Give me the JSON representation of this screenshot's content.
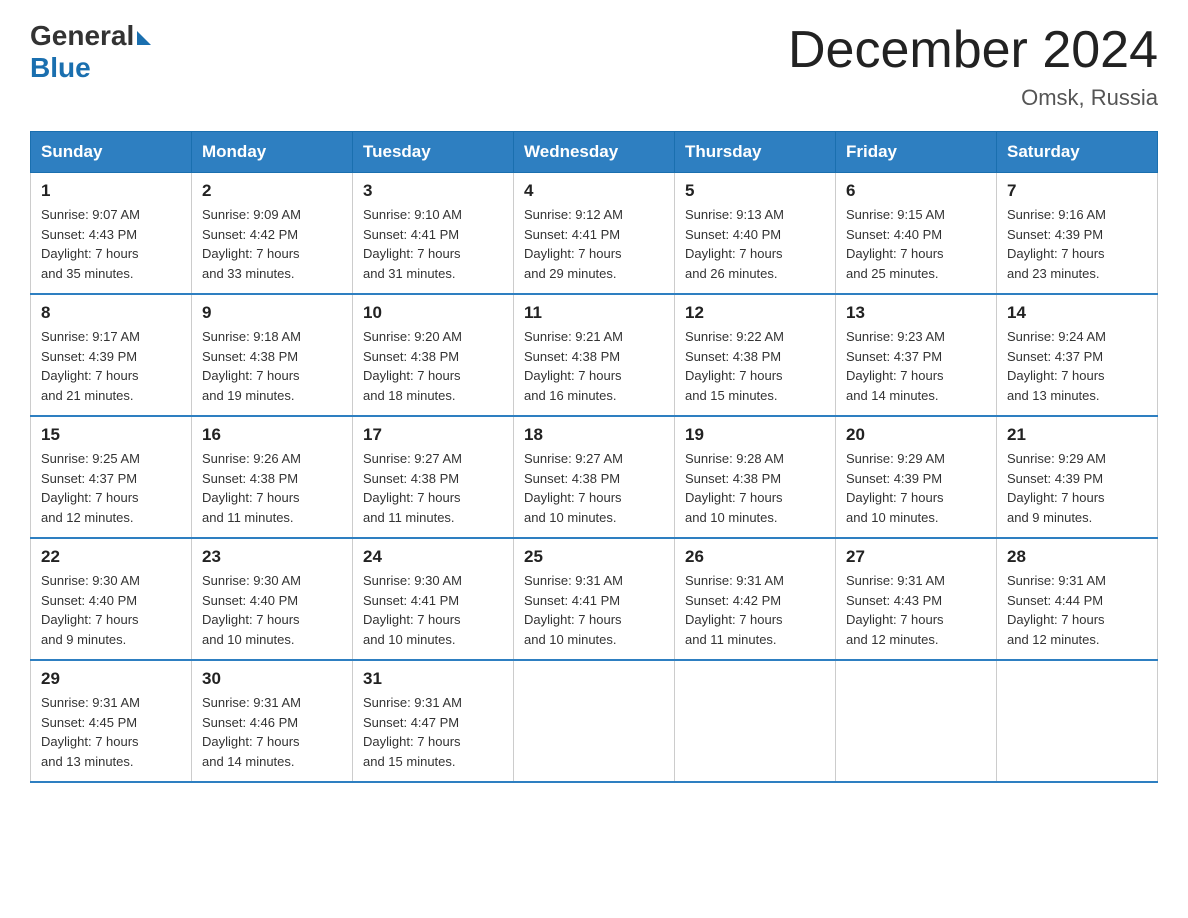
{
  "header": {
    "logo_general": "General",
    "logo_blue": "Blue",
    "month_title": "December 2024",
    "location": "Omsk, Russia"
  },
  "days_of_week": [
    "Sunday",
    "Monday",
    "Tuesday",
    "Wednesday",
    "Thursday",
    "Friday",
    "Saturday"
  ],
  "weeks": [
    [
      {
        "day": "1",
        "sunrise": "9:07 AM",
        "sunset": "4:43 PM",
        "daylight": "7 hours and 35 minutes."
      },
      {
        "day": "2",
        "sunrise": "9:09 AM",
        "sunset": "4:42 PM",
        "daylight": "7 hours and 33 minutes."
      },
      {
        "day": "3",
        "sunrise": "9:10 AM",
        "sunset": "4:41 PM",
        "daylight": "7 hours and 31 minutes."
      },
      {
        "day": "4",
        "sunrise": "9:12 AM",
        "sunset": "4:41 PM",
        "daylight": "7 hours and 29 minutes."
      },
      {
        "day": "5",
        "sunrise": "9:13 AM",
        "sunset": "4:40 PM",
        "daylight": "7 hours and 26 minutes."
      },
      {
        "day": "6",
        "sunrise": "9:15 AM",
        "sunset": "4:40 PM",
        "daylight": "7 hours and 25 minutes."
      },
      {
        "day": "7",
        "sunrise": "9:16 AM",
        "sunset": "4:39 PM",
        "daylight": "7 hours and 23 minutes."
      }
    ],
    [
      {
        "day": "8",
        "sunrise": "9:17 AM",
        "sunset": "4:39 PM",
        "daylight": "7 hours and 21 minutes."
      },
      {
        "day": "9",
        "sunrise": "9:18 AM",
        "sunset": "4:38 PM",
        "daylight": "7 hours and 19 minutes."
      },
      {
        "day": "10",
        "sunrise": "9:20 AM",
        "sunset": "4:38 PM",
        "daylight": "7 hours and 18 minutes."
      },
      {
        "day": "11",
        "sunrise": "9:21 AM",
        "sunset": "4:38 PM",
        "daylight": "7 hours and 16 minutes."
      },
      {
        "day": "12",
        "sunrise": "9:22 AM",
        "sunset": "4:38 PM",
        "daylight": "7 hours and 15 minutes."
      },
      {
        "day": "13",
        "sunrise": "9:23 AM",
        "sunset": "4:37 PM",
        "daylight": "7 hours and 14 minutes."
      },
      {
        "day": "14",
        "sunrise": "9:24 AM",
        "sunset": "4:37 PM",
        "daylight": "7 hours and 13 minutes."
      }
    ],
    [
      {
        "day": "15",
        "sunrise": "9:25 AM",
        "sunset": "4:37 PM",
        "daylight": "7 hours and 12 minutes."
      },
      {
        "day": "16",
        "sunrise": "9:26 AM",
        "sunset": "4:38 PM",
        "daylight": "7 hours and 11 minutes."
      },
      {
        "day": "17",
        "sunrise": "9:27 AM",
        "sunset": "4:38 PM",
        "daylight": "7 hours and 11 minutes."
      },
      {
        "day": "18",
        "sunrise": "9:27 AM",
        "sunset": "4:38 PM",
        "daylight": "7 hours and 10 minutes."
      },
      {
        "day": "19",
        "sunrise": "9:28 AM",
        "sunset": "4:38 PM",
        "daylight": "7 hours and 10 minutes."
      },
      {
        "day": "20",
        "sunrise": "9:29 AM",
        "sunset": "4:39 PM",
        "daylight": "7 hours and 10 minutes."
      },
      {
        "day": "21",
        "sunrise": "9:29 AM",
        "sunset": "4:39 PM",
        "daylight": "7 hours and 9 minutes."
      }
    ],
    [
      {
        "day": "22",
        "sunrise": "9:30 AM",
        "sunset": "4:40 PM",
        "daylight": "7 hours and 9 minutes."
      },
      {
        "day": "23",
        "sunrise": "9:30 AM",
        "sunset": "4:40 PM",
        "daylight": "7 hours and 10 minutes."
      },
      {
        "day": "24",
        "sunrise": "9:30 AM",
        "sunset": "4:41 PM",
        "daylight": "7 hours and 10 minutes."
      },
      {
        "day": "25",
        "sunrise": "9:31 AM",
        "sunset": "4:41 PM",
        "daylight": "7 hours and 10 minutes."
      },
      {
        "day": "26",
        "sunrise": "9:31 AM",
        "sunset": "4:42 PM",
        "daylight": "7 hours and 11 minutes."
      },
      {
        "day": "27",
        "sunrise": "9:31 AM",
        "sunset": "4:43 PM",
        "daylight": "7 hours and 12 minutes."
      },
      {
        "day": "28",
        "sunrise": "9:31 AM",
        "sunset": "4:44 PM",
        "daylight": "7 hours and 12 minutes."
      }
    ],
    [
      {
        "day": "29",
        "sunrise": "9:31 AM",
        "sunset": "4:45 PM",
        "daylight": "7 hours and 13 minutes."
      },
      {
        "day": "30",
        "sunrise": "9:31 AM",
        "sunset": "4:46 PM",
        "daylight": "7 hours and 14 minutes."
      },
      {
        "day": "31",
        "sunrise": "9:31 AM",
        "sunset": "4:47 PM",
        "daylight": "7 hours and 15 minutes."
      },
      null,
      null,
      null,
      null
    ]
  ]
}
